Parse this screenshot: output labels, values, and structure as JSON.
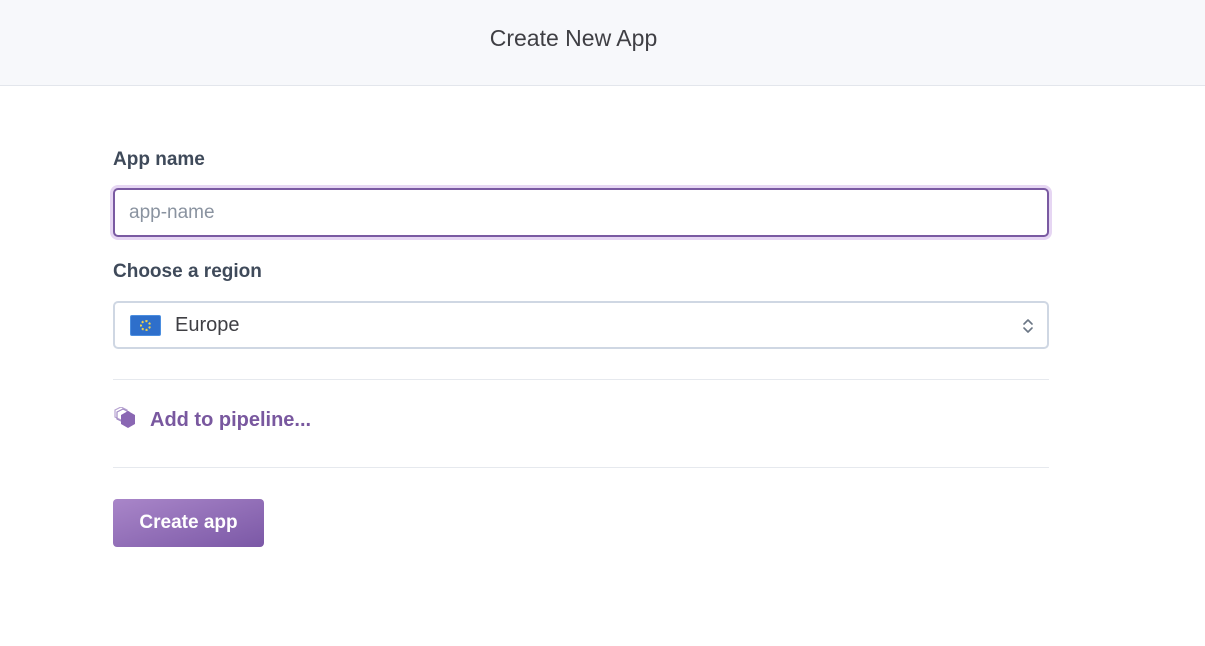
{
  "header": {
    "title": "Create New App"
  },
  "form": {
    "app_name": {
      "label": "App name",
      "value": "",
      "placeholder": "app-name"
    },
    "region": {
      "label": "Choose a region",
      "selected": "Europe",
      "flag_icon": "eu-flag-icon"
    },
    "pipeline": {
      "label": "Add to pipeline...",
      "icon": "pipeline-hexagon-icon"
    },
    "submit_label": "Create app"
  },
  "colors": {
    "accent": "#79589f",
    "button_gradient_start": "#a986c9",
    "button_gradient_end": "#7b58a6",
    "header_bg": "#f7f8fb"
  }
}
